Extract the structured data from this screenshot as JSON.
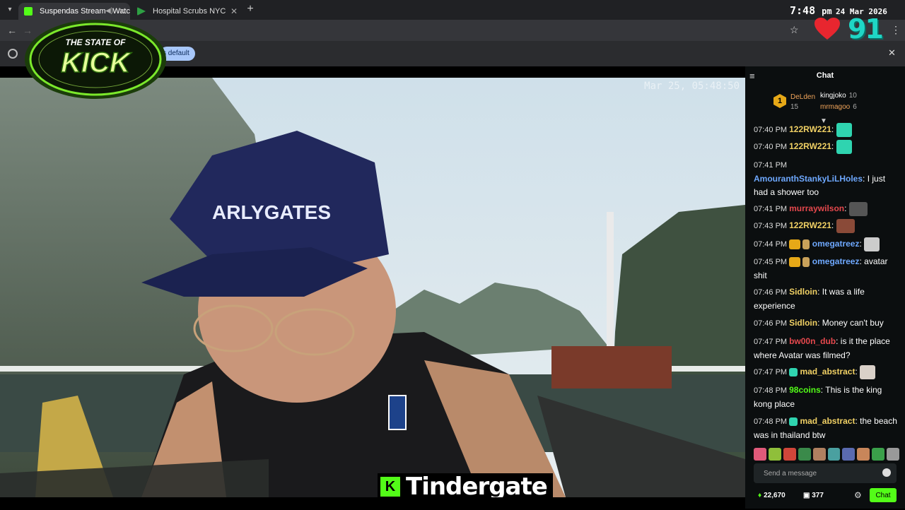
{
  "browser": {
    "tabs": [
      {
        "label": "Suspendas Stream - Watch",
        "favicon_color": "#53fc18",
        "active": true
      },
      {
        "label": "Hospital Scrubs NYC",
        "favicon_color": "#2ea043",
        "active": false
      }
    ],
    "new_tab": "+",
    "back": "←",
    "forward": "→",
    "star": "☆",
    "menu": "⋮",
    "infobar_pill": "s default",
    "infobar_close": "✕"
  },
  "overlay": {
    "time": "7:48",
    "ampm": "pm",
    "date": "24 Mar 2026",
    "logo_line1": "THE STATE OF",
    "logo_line2": "KICK",
    "count": "91"
  },
  "video": {
    "timestamp": "Mar 25, 05:48:50",
    "caption_icon": "K",
    "caption": "Tindergate"
  },
  "chat": {
    "collapse_icon": "≡",
    "title": "Chat",
    "leaderboard": {
      "first": {
        "rank": "1",
        "name": "DeLden",
        "count": "15"
      },
      "second": {
        "name": "kingjoko",
        "count": "10"
      },
      "third": {
        "name": "mrmagoo",
        "count": "6"
      }
    },
    "messages": [
      {
        "time": "07:40 PM",
        "user": "122RW221",
        "color": "#f0d064",
        "text": ""
      },
      {
        "time": "07:40 PM",
        "user": "122RW221",
        "color": "#f0d064",
        "text": ""
      },
      {
        "time": "07:41 PM",
        "user": "AmouranthStankyLiLHoles",
        "color": "#6ea8fe",
        "text": " I just had a shower too"
      },
      {
        "time": "07:41 PM",
        "user": "murraywilson",
        "color": "#e5484d",
        "text": ""
      },
      {
        "time": "07:43 PM",
        "user": "122RW221",
        "color": "#f0d064",
        "text": ""
      },
      {
        "time": "07:44 PM",
        "user": "omegatreez",
        "color": "#6ea8fe",
        "text": ""
      },
      {
        "time": "07:45 PM",
        "user": "omegatreez",
        "color": "#6ea8fe",
        "text": " avatar shit"
      },
      {
        "time": "07:46 PM",
        "user": "Sidloin",
        "color": "#f0d064",
        "text": " It was a life experience"
      },
      {
        "time": "07:46 PM",
        "user": "Sidloin",
        "color": "#f0d064",
        "text": " Money can't buy"
      },
      {
        "time": "07:47 PM",
        "user": "bw00n_dub",
        "color": "#e5484d",
        "text": " is it the place where Avatar was filmed?"
      },
      {
        "time": "07:47 PM",
        "user": "mad_abstract",
        "color": "#f0d064",
        "text": ""
      },
      {
        "time": "07:48 PM",
        "user": "98coins",
        "color": "#53fc18",
        "text": " This is the king kong place"
      },
      {
        "time": "07:48 PM",
        "user": "mad_abstract",
        "color": "#f0d064",
        "text": " the beach was in thailand btw"
      }
    ],
    "input_placeholder": "Send a message",
    "points": "22,670",
    "badge_count": "377",
    "send_label": "Chat",
    "accent": "#53fc18"
  }
}
